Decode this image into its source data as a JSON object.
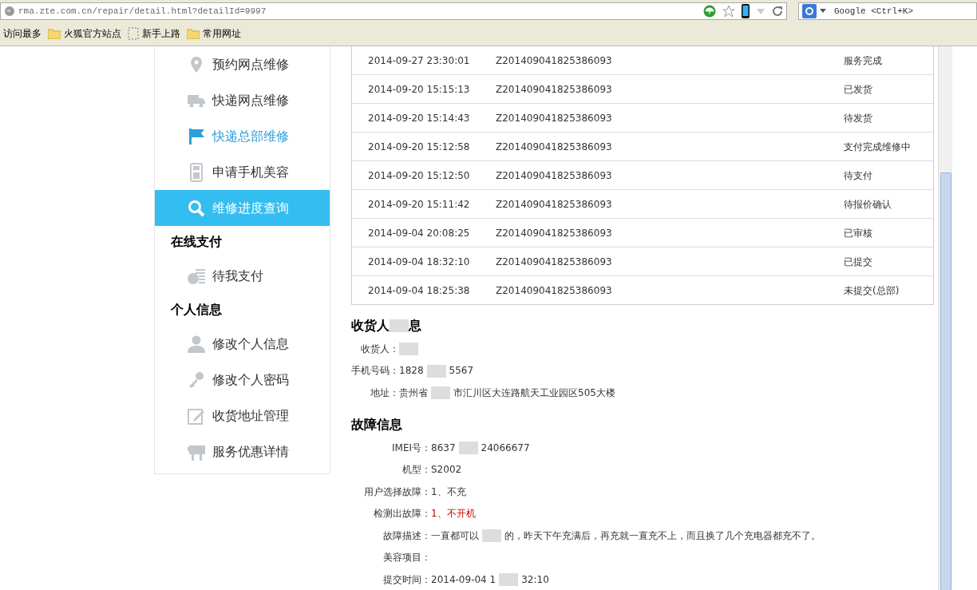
{
  "browser": {
    "url": "rma.zte.com.cn/repair/detail.html?detailId=9997",
    "search_placeholder": "Google <Ctrl+K>",
    "bookmarks": [
      {
        "label": "访问最多",
        "kind": "plain"
      },
      {
        "label": "火狐官方站点",
        "kind": "folder"
      },
      {
        "label": "新手上路",
        "kind": "page"
      },
      {
        "label": "常用网址",
        "kind": "folder"
      }
    ]
  },
  "sidebar": [
    {
      "kind": "item",
      "label": "预约网点维修",
      "selected": false,
      "hovered": false
    },
    {
      "kind": "item",
      "label": "快递网点维修",
      "selected": false,
      "hovered": false
    },
    {
      "kind": "item",
      "label": "快递总部维修",
      "selected": false,
      "hovered": true
    },
    {
      "kind": "item",
      "label": "申请手机美容",
      "selected": false,
      "hovered": false
    },
    {
      "kind": "item",
      "label": "维修进度查询",
      "selected": true,
      "hovered": false
    },
    {
      "kind": "heading",
      "label": "在线支付"
    },
    {
      "kind": "item",
      "label": "待我支付",
      "selected": false,
      "hovered": false
    },
    {
      "kind": "heading",
      "label": "个人信息"
    },
    {
      "kind": "item",
      "label": "修改个人信息",
      "selected": false,
      "hovered": false
    },
    {
      "kind": "item",
      "label": "修改个人密码",
      "selected": false,
      "hovered": false
    },
    {
      "kind": "item",
      "label": "收货地址管理",
      "selected": false,
      "hovered": false
    },
    {
      "kind": "item",
      "label": "服务优惠详情",
      "selected": false,
      "hovered": false
    }
  ],
  "history": [
    {
      "time": "2014-09-27 23:30:01",
      "order": "Z201409041825386093",
      "status": "服务完成"
    },
    {
      "time": "2014-09-20 15:15:13",
      "order": "Z201409041825386093",
      "status": "已发货"
    },
    {
      "time": "2014-09-20 15:14:43",
      "order": "Z201409041825386093",
      "status": "待发货"
    },
    {
      "time": "2014-09-20 15:12:58",
      "order": "Z201409041825386093",
      "status": "支付完成维修中"
    },
    {
      "time": "2014-09-20 15:12:50",
      "order": "Z201409041825386093",
      "status": "待支付"
    },
    {
      "time": "2014-09-20 15:11:42",
      "order": "Z201409041825386093",
      "status": "待报价确认"
    },
    {
      "time": "2014-09-04 20:08:25",
      "order": "Z201409041825386093",
      "status": "已审核"
    },
    {
      "time": "2014-09-04 18:32:10",
      "order": "Z201409041825386093",
      "status": "已提交"
    },
    {
      "time": "2014-09-04 18:25:38",
      "order": "Z201409041825386093",
      "status": "未提交(总部)"
    }
  ],
  "sections": [
    {
      "title": [
        "收货人",
        "息"
      ],
      "fields": [
        {
          "label": "收货人：",
          "redacted": true
        },
        {
          "label": "手机号码：",
          "value": [
            "1828",
            "5567"
          ],
          "alert": false
        },
        {
          "label": "地址：",
          "value": [
            "贵州省",
            "市汇川区大连路航天工业园区505大楼"
          ],
          "alert": false
        }
      ]
    },
    {
      "title": [
        "故障信息"
      ],
      "fields": [
        {
          "label": "IMEI号：",
          "value": [
            "8637",
            "24066677"
          ],
          "alert": false
        },
        {
          "label": "机型：",
          "value": [
            "S2002"
          ],
          "alert": false
        },
        {
          "label": "用户选择故障：",
          "value": [
            "1、不充"
          ],
          "alert": false
        },
        {
          "label": "检测出故障：",
          "value": [
            "1、不开机"
          ],
          "alert": true
        },
        {
          "label": "故障描述：",
          "value": [
            "一直都可以",
            "的，昨天下午充满后，再充就一直充不上，而且换了几个充电器都充不了。"
          ],
          "alert": false
        },
        {
          "label": "美容项目："
        },
        {
          "label": "提交时间：",
          "value": [
            "2014-09-04 1",
            "32:10"
          ],
          "alert": false
        }
      ]
    }
  ]
}
